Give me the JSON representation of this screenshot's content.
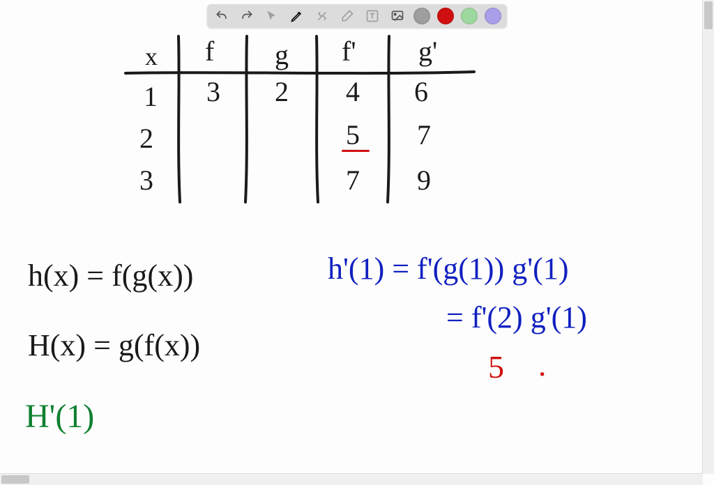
{
  "toolbar": {
    "colors": {
      "gray": "#9e9e9e",
      "red": "#d01010",
      "green": "#9fd89f",
      "purple": "#a89fe8"
    }
  },
  "table": {
    "headers": {
      "x": "x",
      "f": "f",
      "g": "g",
      "fp": "f'",
      "gp": "g'"
    },
    "rows": [
      {
        "x": "1",
        "f": "3",
        "g": "2",
        "fp": "4",
        "gp": "6"
      },
      {
        "x": "2",
        "f": "",
        "g": "",
        "fp": "5",
        "gp": "7"
      },
      {
        "x": "3",
        "f": "",
        "g": "",
        "fp": "7",
        "gp": "9"
      }
    ]
  },
  "equations": {
    "h_def": "h(x) = f(g(x))",
    "H_def": "H(x) = g(f(x))",
    "Hprime1": "H'(1)",
    "hprime1_line1": "h'(1) = f'(g(1)) g'(1)",
    "hprime1_line2": "= f'(2) g'(1)",
    "result_5": "5",
    "result_dot": "·"
  }
}
